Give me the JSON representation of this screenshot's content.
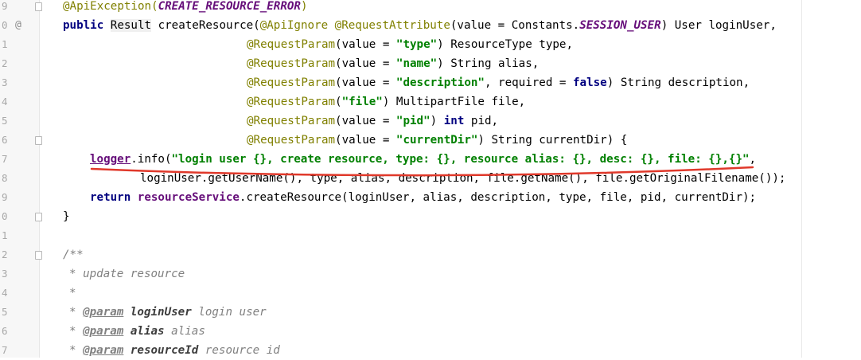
{
  "lines": [
    {
      "n": "9",
      "gutter_icon": "",
      "fold": true,
      "indent": 79,
      "tokens": [
        {
          "t": "@ApiException(",
          "c": "ann"
        },
        {
          "t": "CREATE_RESOURCE_ERROR",
          "c": "const"
        },
        {
          "t": ")",
          "c": "ann"
        }
      ]
    },
    {
      "n": "0",
      "gutter_icon": "@",
      "fold": false,
      "indent": 79,
      "tokens": [
        {
          "t": "public ",
          "c": "kw"
        },
        {
          "t": "Result",
          "c": "hl"
        },
        {
          "t": " createResource(",
          "c": ""
        },
        {
          "t": "@ApiIgnore @RequestAttribute",
          "c": "ann"
        },
        {
          "t": "(value = Constants.",
          "c": ""
        },
        {
          "t": "SESSION_USER",
          "c": "const"
        },
        {
          "t": ") User loginUser,",
          "c": ""
        }
      ]
    },
    {
      "n": "1",
      "gutter_icon": "",
      "fold": false,
      "indent": 310,
      "tokens": [
        {
          "t": "@RequestParam",
          "c": "ann"
        },
        {
          "t": "(value = ",
          "c": ""
        },
        {
          "t": "\"type\"",
          "c": "str"
        },
        {
          "t": ") ResourceType type,",
          "c": ""
        }
      ]
    },
    {
      "n": "2",
      "gutter_icon": "",
      "fold": false,
      "indent": 310,
      "tokens": [
        {
          "t": "@RequestParam",
          "c": "ann"
        },
        {
          "t": "(value = ",
          "c": ""
        },
        {
          "t": "\"name\"",
          "c": "str"
        },
        {
          "t": ") String alias,",
          "c": ""
        }
      ]
    },
    {
      "n": "3",
      "gutter_icon": "",
      "fold": false,
      "indent": 310,
      "tokens": [
        {
          "t": "@RequestParam",
          "c": "ann"
        },
        {
          "t": "(value = ",
          "c": ""
        },
        {
          "t": "\"description\"",
          "c": "str"
        },
        {
          "t": ", required = ",
          "c": ""
        },
        {
          "t": "false",
          "c": "kw"
        },
        {
          "t": ") String description,",
          "c": ""
        }
      ]
    },
    {
      "n": "4",
      "gutter_icon": "",
      "fold": false,
      "indent": 310,
      "tokens": [
        {
          "t": "@RequestParam",
          "c": "ann"
        },
        {
          "t": "(",
          "c": ""
        },
        {
          "t": "\"file\"",
          "c": "str"
        },
        {
          "t": ") MultipartFile file,",
          "c": ""
        }
      ]
    },
    {
      "n": "5",
      "gutter_icon": "",
      "fold": false,
      "indent": 310,
      "tokens": [
        {
          "t": "@RequestParam",
          "c": "ann"
        },
        {
          "t": "(value = ",
          "c": ""
        },
        {
          "t": "\"pid\"",
          "c": "str"
        },
        {
          "t": ") ",
          "c": ""
        },
        {
          "t": "int",
          "c": "kw"
        },
        {
          "t": " pid,",
          "c": ""
        }
      ]
    },
    {
      "n": "6",
      "gutter_icon": "",
      "fold": true,
      "indent": 310,
      "tokens": [
        {
          "t": "@RequestParam",
          "c": "ann"
        },
        {
          "t": "(value = ",
          "c": ""
        },
        {
          "t": "\"currentDir\"",
          "c": "str"
        },
        {
          "t": ") String currentDir) {",
          "c": ""
        }
      ]
    },
    {
      "n": "7",
      "gutter_icon": "",
      "fold": false,
      "indent": 113,
      "tokens": [
        {
          "t": "logger",
          "c": "field ul"
        },
        {
          "t": ".info(",
          "c": ""
        },
        {
          "t": "\"login user {}, create resource, type: {}, resource alias: {}, desc: {}, file: {},{}\"",
          "c": "str"
        },
        {
          "t": ",",
          "c": ""
        }
      ]
    },
    {
      "n": "8",
      "gutter_icon": "",
      "fold": false,
      "indent": 176,
      "tokens": [
        {
          "t": "loginUser.getUserName(), type, alias, description, file.getName(), file.getOriginalFilename());",
          "c": ""
        }
      ]
    },
    {
      "n": "9",
      "gutter_icon": "",
      "fold": false,
      "indent": 113,
      "tokens": [
        {
          "t": "return ",
          "c": "kw"
        },
        {
          "t": "resourceService",
          "c": "field"
        },
        {
          "t": ".createResource(loginUser, alias, description, type, file, pid, currentDir);",
          "c": ""
        }
      ]
    },
    {
      "n": "0",
      "gutter_icon": "",
      "fold": true,
      "indent": 79,
      "tokens": [
        {
          "t": "}",
          "c": ""
        }
      ]
    },
    {
      "n": "1",
      "gutter_icon": "",
      "fold": false,
      "indent": 79,
      "tokens": []
    },
    {
      "n": "2",
      "gutter_icon": "",
      "fold": true,
      "indent": 79,
      "tokens": [
        {
          "t": "/**",
          "c": "cmt"
        }
      ]
    },
    {
      "n": "3",
      "gutter_icon": "",
      "fold": false,
      "indent": 87,
      "tokens": [
        {
          "t": "* update resource",
          "c": "cmt"
        }
      ]
    },
    {
      "n": "4",
      "gutter_icon": "",
      "fold": false,
      "indent": 87,
      "tokens": [
        {
          "t": "*",
          "c": "cmt"
        }
      ]
    },
    {
      "n": "5",
      "gutter_icon": "",
      "fold": false,
      "indent": 87,
      "tokens": [
        {
          "t": "* ",
          "c": "cmt"
        },
        {
          "t": "@param",
          "c": "tag"
        },
        {
          "t": " ",
          "c": "cmt"
        },
        {
          "t": "loginUser",
          "c": "pname"
        },
        {
          "t": " login user",
          "c": "cmt"
        }
      ]
    },
    {
      "n": "6",
      "gutter_icon": "",
      "fold": false,
      "indent": 87,
      "tokens": [
        {
          "t": "* ",
          "c": "cmt"
        },
        {
          "t": "@param",
          "c": "tag"
        },
        {
          "t": " ",
          "c": "cmt"
        },
        {
          "t": "alias",
          "c": "pname"
        },
        {
          "t": " alias",
          "c": "cmt"
        }
      ]
    },
    {
      "n": "7",
      "gutter_icon": "",
      "fold": false,
      "indent": 87,
      "tokens": [
        {
          "t": "* ",
          "c": "cmt"
        },
        {
          "t": "@param",
          "c": "tag"
        },
        {
          "t": " ",
          "c": "cmt"
        },
        {
          "t": "resourceId",
          "c": "pname"
        },
        {
          "t": " resource id",
          "c": "cmt"
        }
      ]
    }
  ],
  "colors": {
    "keyword": "#000080",
    "annotation": "#808000",
    "string": "#008000",
    "constant": "#660e7a",
    "comment": "#808080",
    "strike_mark": "#e0392b"
  }
}
